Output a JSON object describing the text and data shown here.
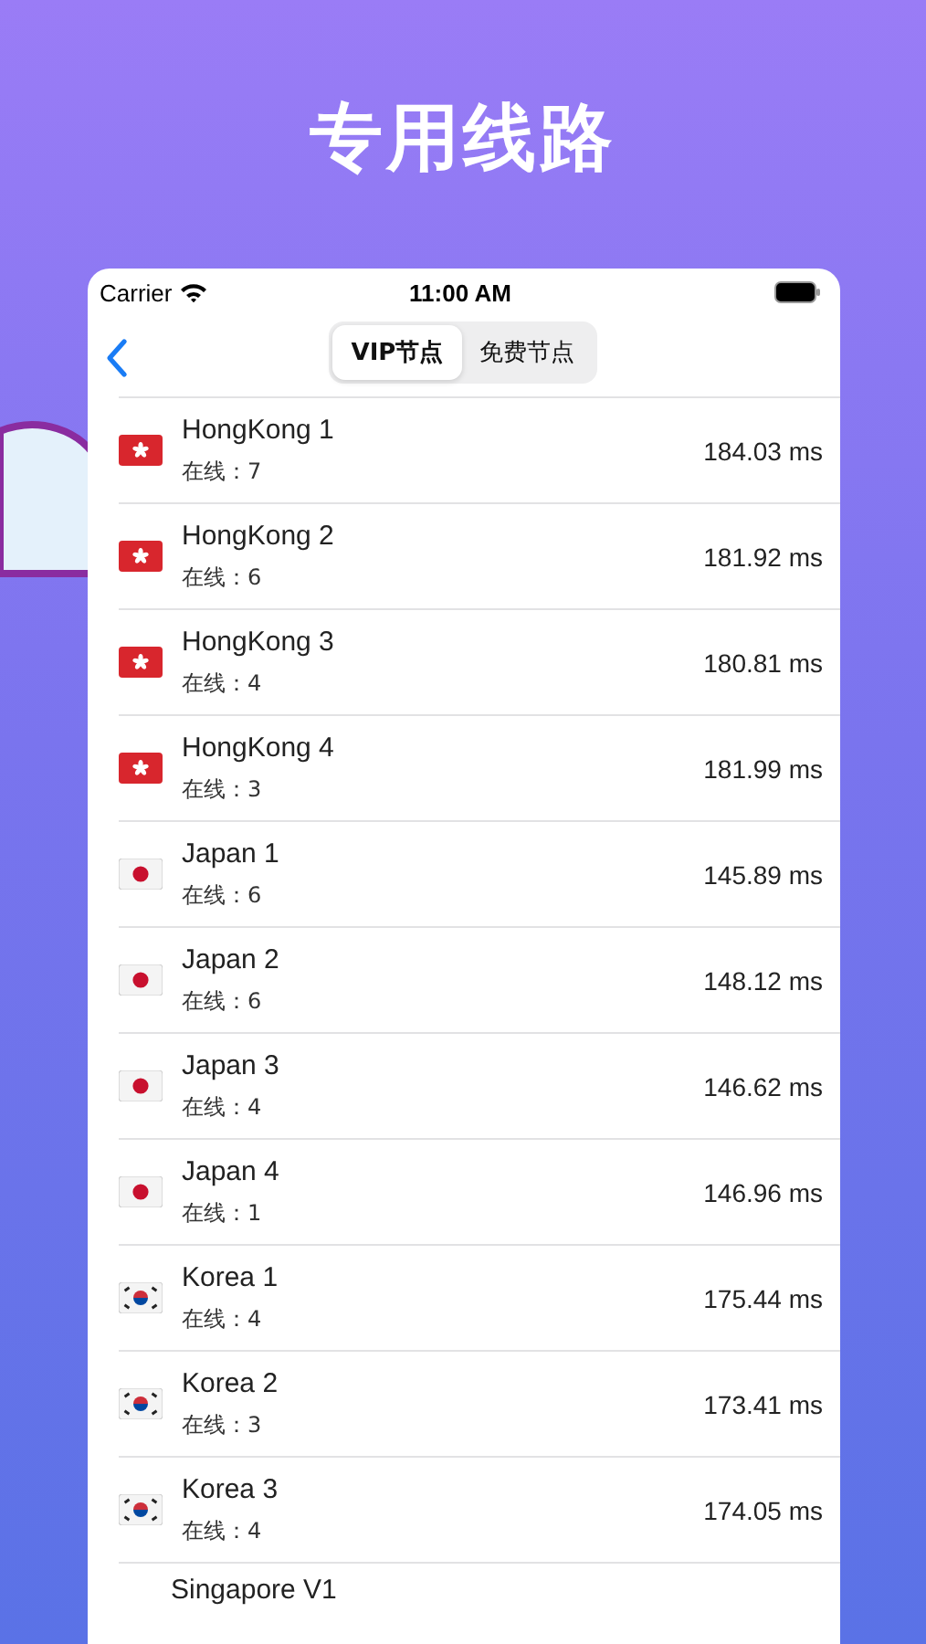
{
  "headline": "专用线路",
  "status_bar": {
    "carrier": "Carrier",
    "time": "11:00 AM"
  },
  "segments": [
    {
      "label": "VIP节点",
      "selected": true
    },
    {
      "label": "免费节点",
      "selected": false
    }
  ],
  "servers": [
    {
      "kind": "hk",
      "name": "HongKong 1",
      "online": "在线：7",
      "latency": "184.03 ms"
    },
    {
      "kind": "hk",
      "name": "HongKong 2",
      "online": "在线：6",
      "latency": "181.92 ms"
    },
    {
      "kind": "hk",
      "name": "HongKong 3",
      "online": "在线：4",
      "latency": "180.81 ms"
    },
    {
      "kind": "hk",
      "name": "HongKong 4",
      "online": "在线：3",
      "latency": "181.99 ms"
    },
    {
      "kind": "jp",
      "name": "Japan 1",
      "online": "在线：6",
      "latency": "145.89 ms"
    },
    {
      "kind": "jp",
      "name": "Japan 2",
      "online": "在线：6",
      "latency": "148.12 ms"
    },
    {
      "kind": "jp",
      "name": "Japan 3",
      "online": "在线：4",
      "latency": "146.62 ms"
    },
    {
      "kind": "jp",
      "name": "Japan 4",
      "online": "在线：1",
      "latency": "146.96 ms"
    },
    {
      "kind": "kr",
      "name": "Korea 1",
      "online": "在线：4",
      "latency": "175.44 ms"
    },
    {
      "kind": "kr",
      "name": "Korea 2",
      "online": "在线：3",
      "latency": "173.41 ms"
    },
    {
      "kind": "kr",
      "name": "Korea 3",
      "online": "在线：4",
      "latency": "174.05 ms"
    }
  ],
  "partial_server": {
    "name": "Singapore V1"
  }
}
